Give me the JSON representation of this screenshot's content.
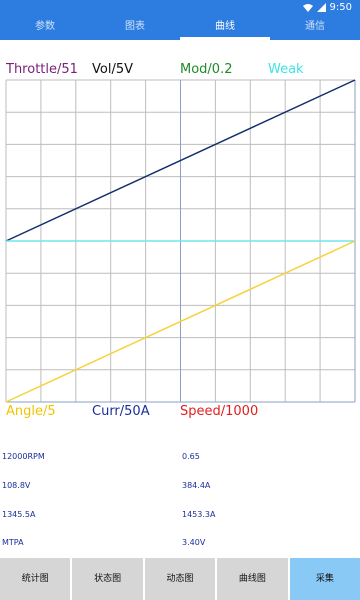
{
  "status": {
    "time": "9:50"
  },
  "tabs": [
    {
      "label": "参数"
    },
    {
      "label": "图表"
    },
    {
      "label": "曲线"
    },
    {
      "label": "通信"
    }
  ],
  "chart": {
    "legend_top": [
      {
        "label": "Throttle/51",
        "color": "#7a1f7a"
      },
      {
        "label": "Vol/5V",
        "color": "#111111"
      },
      {
        "label": "Mod/0.2",
        "color": "#1f8a2a"
      },
      {
        "label": "Weak",
        "color": "#3fe3e3"
      }
    ],
    "legend_bottom": [
      {
        "label": "Angle/5",
        "color": "#f2c400"
      },
      {
        "label": "Curr/50A",
        "color": "#1a2f9a"
      },
      {
        "label": "Speed/1000",
        "color": "#e02020"
      }
    ],
    "colors": {
      "navy_line": "#13306b",
      "cyan_line": "#6fe6ec",
      "yellow_line": "#f7d23a",
      "grid": "#bdbdbd",
      "frame": "#8aa0c6"
    }
  },
  "chart_data": {
    "type": "line",
    "grid": true,
    "x_divisions": 10,
    "y_divisions": 10,
    "series": [
      {
        "name": "navy",
        "color": "#13306b",
        "points": [
          [
            0,
            5
          ],
          [
            10,
            10
          ]
        ]
      },
      {
        "name": "Weak",
        "color": "#6fe6ec",
        "points": [
          [
            0,
            5
          ],
          [
            10,
            5
          ]
        ]
      },
      {
        "name": "Angle/5",
        "color": "#f7d23a",
        "points": [
          [
            0,
            0
          ],
          [
            10,
            5
          ]
        ]
      }
    ]
  },
  "readouts": {
    "left": [
      "12000RPM",
      "108.8V",
      "1345.5A",
      "MTPA"
    ],
    "right": [
      "0.65",
      "384.4A",
      "1453.3A",
      "3.40V"
    ]
  },
  "bottom_buttons": [
    {
      "label": "统计图"
    },
    {
      "label": "状态图"
    },
    {
      "label": "动态图"
    },
    {
      "label": "曲线图"
    },
    {
      "label": "采集"
    }
  ]
}
